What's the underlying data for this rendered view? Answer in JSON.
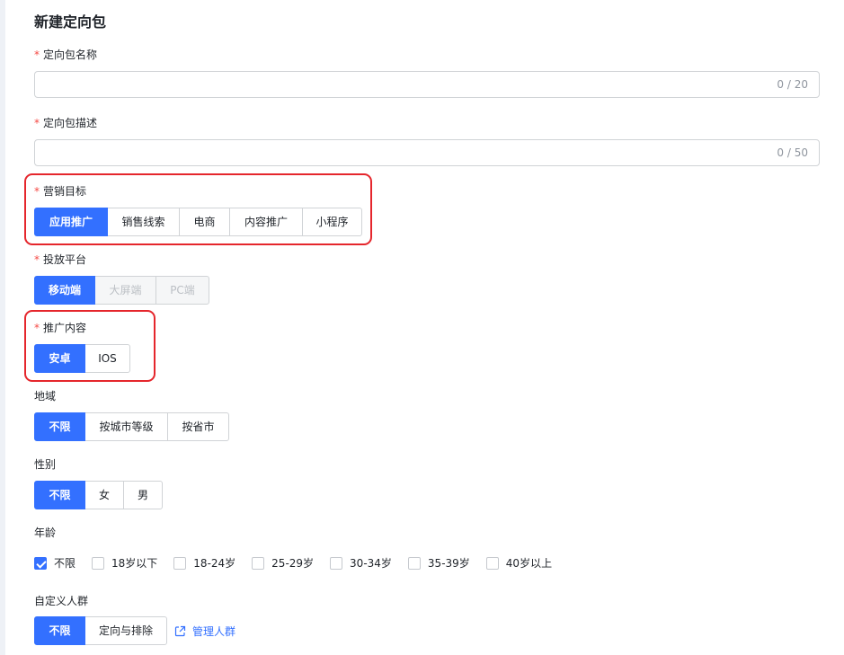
{
  "page_title": "新建定向包",
  "fields": {
    "name": {
      "label": "定向包名称",
      "counter": "0 / 20",
      "value": ""
    },
    "description": {
      "label": "定向包描述",
      "counter": "0 / 50",
      "value": ""
    },
    "marketing_goal": {
      "label": "营销目标",
      "options": [
        "应用推广",
        "销售线索",
        "电商",
        "内容推广",
        "小程序"
      ],
      "selected": "应用推广"
    },
    "platform": {
      "label": "投放平台",
      "options": [
        "移动端",
        "大屏端",
        "PC端"
      ],
      "selected": "移动端",
      "disabled": [
        "大屏端",
        "PC端"
      ]
    },
    "promo_content": {
      "label": "推广内容",
      "options": [
        "安卓",
        "IOS"
      ],
      "selected": "安卓"
    },
    "region": {
      "label": "地域",
      "options": [
        "不限",
        "按城市等级",
        "按省市"
      ],
      "selected": "不限"
    },
    "gender": {
      "label": "性别",
      "options": [
        "不限",
        "女",
        "男"
      ],
      "selected": "不限"
    },
    "age": {
      "label": "年龄",
      "options": [
        "不限",
        "18岁以下",
        "18-24岁",
        "25-29岁",
        "30-34岁",
        "35-39岁",
        "40岁以上"
      ],
      "checked": [
        "不限"
      ]
    },
    "custom_audience": {
      "label": "自定义人群",
      "options": [
        "不限",
        "定向与排除"
      ],
      "selected": "不限",
      "manage_link": "管理人群"
    }
  },
  "required_mark": "*",
  "colors": {
    "primary": "#3370ff",
    "required": "#f54a45",
    "highlight": "#e5262c"
  },
  "icons": {
    "manage_link": "external-link-icon",
    "checked": "checkmark-icon"
  }
}
